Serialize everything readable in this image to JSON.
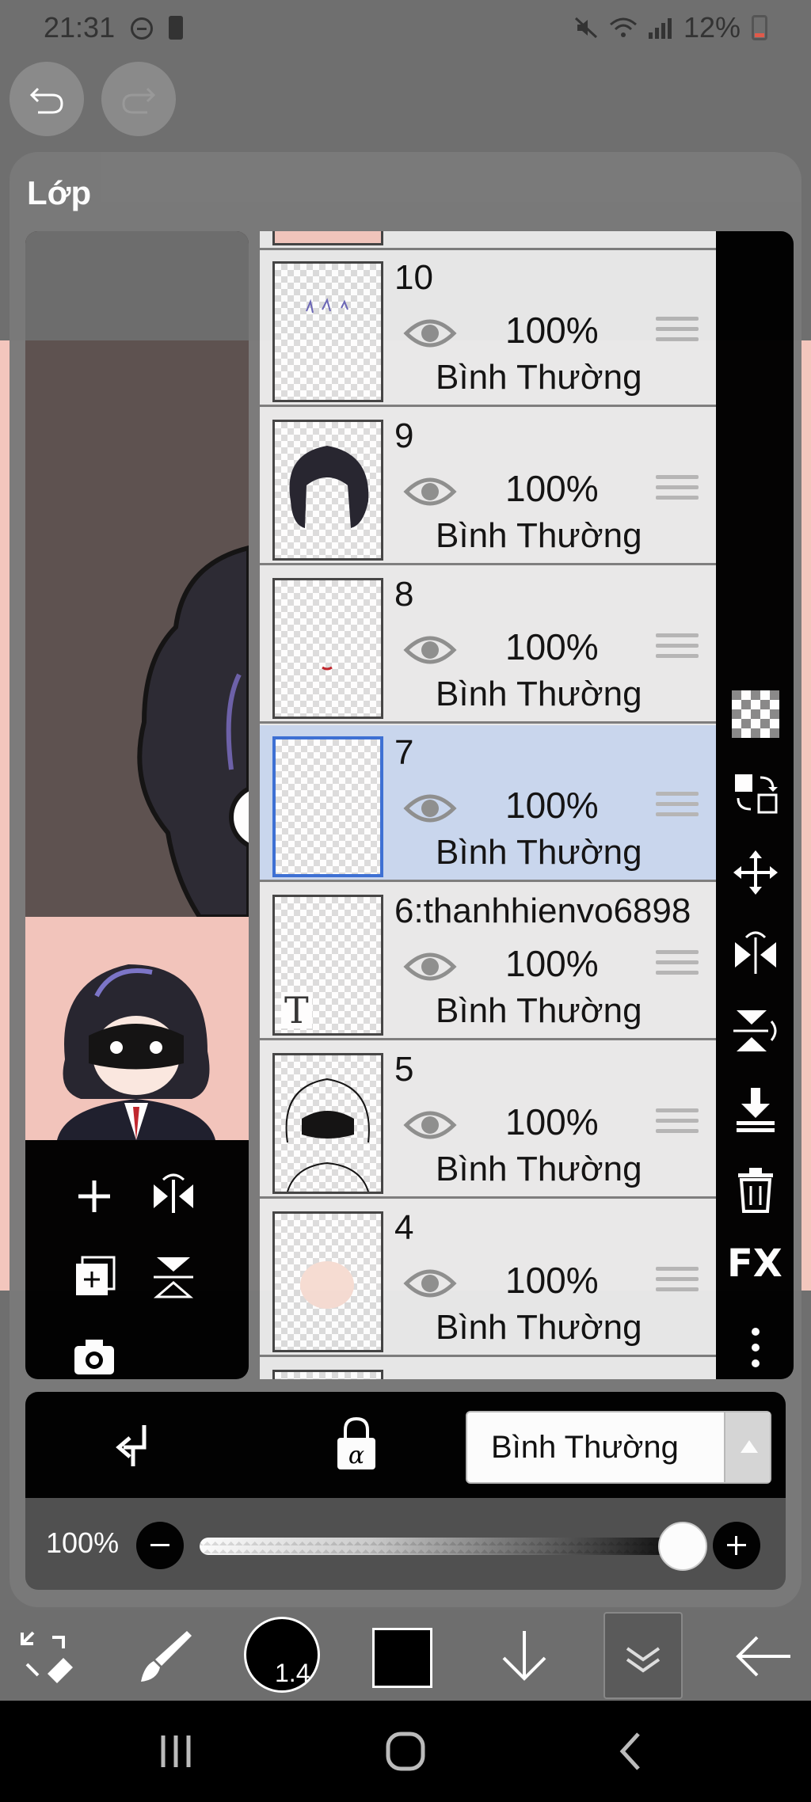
{
  "status_bar": {
    "time": "21:31",
    "battery_percent": "12%"
  },
  "panel": {
    "title": "Lớp"
  },
  "layers": [
    {
      "name": "10",
      "opacity": "100%",
      "blend_mode": "Bình Thường",
      "selected": false
    },
    {
      "name": "9",
      "opacity": "100%",
      "blend_mode": "Bình Thường",
      "selected": false
    },
    {
      "name": "8",
      "opacity": "100%",
      "blend_mode": "Bình Thường",
      "selected": false
    },
    {
      "name": "7",
      "opacity": "100%",
      "blend_mode": "Bình Thường",
      "selected": true
    },
    {
      "name": "6:thanhhienvo6898",
      "opacity": "100%",
      "blend_mode": "Bình Thường",
      "selected": false
    },
    {
      "name": "5",
      "opacity": "100%",
      "blend_mode": "Bình Thường",
      "selected": false
    },
    {
      "name": "4",
      "opacity": "100%",
      "blend_mode": "Bình Thường",
      "selected": false
    }
  ],
  "blend_bar": {
    "blend_mode": "Bình Thường"
  },
  "opacity_bar": {
    "label": "100%",
    "value": 1.0
  },
  "toolbar": {
    "brush_size": "1.4",
    "primary_color": "#000000"
  },
  "colors": {
    "selected_layer": "#c9d7ee",
    "selection_border": "#3b6fd4",
    "canvas_bg": "#f3c6bd"
  }
}
